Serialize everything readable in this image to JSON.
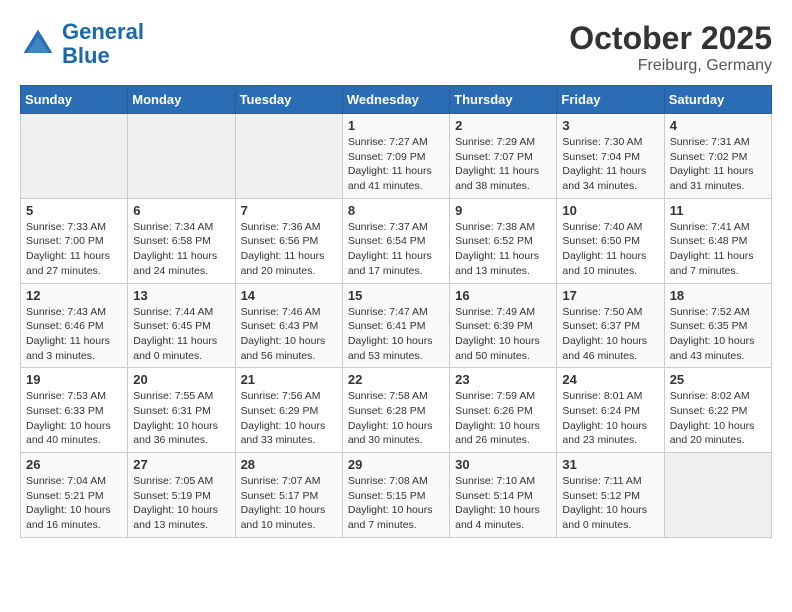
{
  "header": {
    "logo_line1": "General",
    "logo_line2": "Blue",
    "title": "October 2025",
    "subtitle": "Freiburg, Germany"
  },
  "weekdays": [
    "Sunday",
    "Monday",
    "Tuesday",
    "Wednesday",
    "Thursday",
    "Friday",
    "Saturday"
  ],
  "weeks": [
    [
      {
        "day": "",
        "info": ""
      },
      {
        "day": "",
        "info": ""
      },
      {
        "day": "",
        "info": ""
      },
      {
        "day": "1",
        "info": "Sunrise: 7:27 AM\nSunset: 7:09 PM\nDaylight: 11 hours and 41 minutes."
      },
      {
        "day": "2",
        "info": "Sunrise: 7:29 AM\nSunset: 7:07 PM\nDaylight: 11 hours and 38 minutes."
      },
      {
        "day": "3",
        "info": "Sunrise: 7:30 AM\nSunset: 7:04 PM\nDaylight: 11 hours and 34 minutes."
      },
      {
        "day": "4",
        "info": "Sunrise: 7:31 AM\nSunset: 7:02 PM\nDaylight: 11 hours and 31 minutes."
      }
    ],
    [
      {
        "day": "5",
        "info": "Sunrise: 7:33 AM\nSunset: 7:00 PM\nDaylight: 11 hours and 27 minutes."
      },
      {
        "day": "6",
        "info": "Sunrise: 7:34 AM\nSunset: 6:58 PM\nDaylight: 11 hours and 24 minutes."
      },
      {
        "day": "7",
        "info": "Sunrise: 7:36 AM\nSunset: 6:56 PM\nDaylight: 11 hours and 20 minutes."
      },
      {
        "day": "8",
        "info": "Sunrise: 7:37 AM\nSunset: 6:54 PM\nDaylight: 11 hours and 17 minutes."
      },
      {
        "day": "9",
        "info": "Sunrise: 7:38 AM\nSunset: 6:52 PM\nDaylight: 11 hours and 13 minutes."
      },
      {
        "day": "10",
        "info": "Sunrise: 7:40 AM\nSunset: 6:50 PM\nDaylight: 11 hours and 10 minutes."
      },
      {
        "day": "11",
        "info": "Sunrise: 7:41 AM\nSunset: 6:48 PM\nDaylight: 11 hours and 7 minutes."
      }
    ],
    [
      {
        "day": "12",
        "info": "Sunrise: 7:43 AM\nSunset: 6:46 PM\nDaylight: 11 hours and 3 minutes."
      },
      {
        "day": "13",
        "info": "Sunrise: 7:44 AM\nSunset: 6:45 PM\nDaylight: 11 hours and 0 minutes."
      },
      {
        "day": "14",
        "info": "Sunrise: 7:46 AM\nSunset: 6:43 PM\nDaylight: 10 hours and 56 minutes."
      },
      {
        "day": "15",
        "info": "Sunrise: 7:47 AM\nSunset: 6:41 PM\nDaylight: 10 hours and 53 minutes."
      },
      {
        "day": "16",
        "info": "Sunrise: 7:49 AM\nSunset: 6:39 PM\nDaylight: 10 hours and 50 minutes."
      },
      {
        "day": "17",
        "info": "Sunrise: 7:50 AM\nSunset: 6:37 PM\nDaylight: 10 hours and 46 minutes."
      },
      {
        "day": "18",
        "info": "Sunrise: 7:52 AM\nSunset: 6:35 PM\nDaylight: 10 hours and 43 minutes."
      }
    ],
    [
      {
        "day": "19",
        "info": "Sunrise: 7:53 AM\nSunset: 6:33 PM\nDaylight: 10 hours and 40 minutes."
      },
      {
        "day": "20",
        "info": "Sunrise: 7:55 AM\nSunset: 6:31 PM\nDaylight: 10 hours and 36 minutes."
      },
      {
        "day": "21",
        "info": "Sunrise: 7:56 AM\nSunset: 6:29 PM\nDaylight: 10 hours and 33 minutes."
      },
      {
        "day": "22",
        "info": "Sunrise: 7:58 AM\nSunset: 6:28 PM\nDaylight: 10 hours and 30 minutes."
      },
      {
        "day": "23",
        "info": "Sunrise: 7:59 AM\nSunset: 6:26 PM\nDaylight: 10 hours and 26 minutes."
      },
      {
        "day": "24",
        "info": "Sunrise: 8:01 AM\nSunset: 6:24 PM\nDaylight: 10 hours and 23 minutes."
      },
      {
        "day": "25",
        "info": "Sunrise: 8:02 AM\nSunset: 6:22 PM\nDaylight: 10 hours and 20 minutes."
      }
    ],
    [
      {
        "day": "26",
        "info": "Sunrise: 7:04 AM\nSunset: 5:21 PM\nDaylight: 10 hours and 16 minutes."
      },
      {
        "day": "27",
        "info": "Sunrise: 7:05 AM\nSunset: 5:19 PM\nDaylight: 10 hours and 13 minutes."
      },
      {
        "day": "28",
        "info": "Sunrise: 7:07 AM\nSunset: 5:17 PM\nDaylight: 10 hours and 10 minutes."
      },
      {
        "day": "29",
        "info": "Sunrise: 7:08 AM\nSunset: 5:15 PM\nDaylight: 10 hours and 7 minutes."
      },
      {
        "day": "30",
        "info": "Sunrise: 7:10 AM\nSunset: 5:14 PM\nDaylight: 10 hours and 4 minutes."
      },
      {
        "day": "31",
        "info": "Sunrise: 7:11 AM\nSunset: 5:12 PM\nDaylight: 10 hours and 0 minutes."
      },
      {
        "day": "",
        "info": ""
      }
    ]
  ]
}
